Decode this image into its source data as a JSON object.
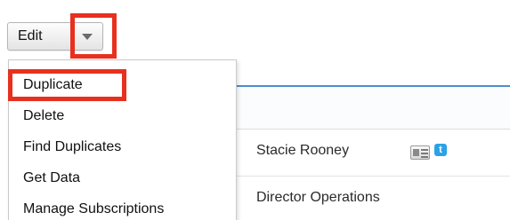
{
  "actions": {
    "edit_label": "Edit",
    "dropdown_icon": "caret-down-icon"
  },
  "menu": {
    "items": [
      {
        "label": "Duplicate"
      },
      {
        "label": "Delete"
      },
      {
        "label": "Find Duplicates"
      },
      {
        "label": "Get Data"
      },
      {
        "label": "Manage Subscriptions"
      }
    ]
  },
  "record": {
    "name": "Stacie Rooney",
    "title": "Director Operations",
    "icons": [
      "vcard-icon",
      "twitter-icon"
    ]
  },
  "colors": {
    "highlight": "#e8301e",
    "accent_rule": "#4a8fcd",
    "twitter": "#2aa2e6"
  }
}
